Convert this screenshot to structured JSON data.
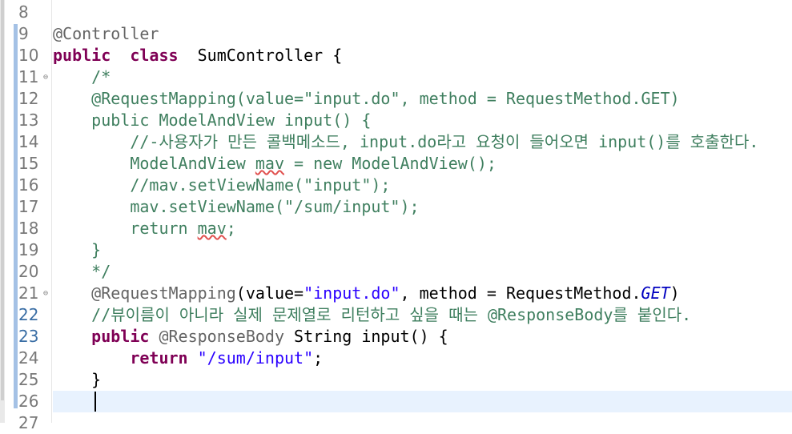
{
  "editor": {
    "lines": [
      {
        "n": "8",
        "segs": []
      },
      {
        "n": "9",
        "segs": [
          [
            "ann",
            "@Controller"
          ]
        ]
      },
      {
        "n": "10",
        "segs": [
          [
            "kw",
            "public"
          ],
          [
            "",
            "  "
          ],
          [
            "kw",
            "class"
          ],
          [
            "",
            "  SumController {"
          ]
        ]
      },
      {
        "n": "11",
        "fold": true,
        "segs": [
          [
            "",
            "    "
          ],
          [
            "cm",
            "/*"
          ]
        ]
      },
      {
        "n": "12",
        "segs": [
          [
            "",
            "    "
          ],
          [
            "cm",
            "@RequestMapping(value=\"input.do\", method = RequestMethod.GET)"
          ]
        ]
      },
      {
        "n": "13",
        "segs": [
          [
            "",
            "    "
          ],
          [
            "cm",
            "public ModelAndView input() {"
          ]
        ]
      },
      {
        "n": "14",
        "segs": [
          [
            "",
            "        "
          ],
          [
            "cm",
            "//-사용자가 만든 콜백메소드, input.do라고 요청이 들어오면 input()를 호출한다."
          ]
        ]
      },
      {
        "n": "15",
        "segs": [
          [
            "",
            "        "
          ],
          [
            "cm",
            "ModelAndView "
          ],
          [
            "cm warn",
            "mav"
          ],
          [
            "cm",
            " = new ModelAndView();"
          ]
        ]
      },
      {
        "n": "16",
        "segs": [
          [
            "",
            "        "
          ],
          [
            "cm",
            "//mav.setViewName(\"input\");"
          ]
        ]
      },
      {
        "n": "17",
        "segs": [
          [
            "",
            "        "
          ],
          [
            "cm",
            "mav.setViewName(\"/sum/input\");"
          ]
        ]
      },
      {
        "n": "18",
        "segs": [
          [
            "",
            "        "
          ],
          [
            "cm",
            "return "
          ],
          [
            "cm warn",
            "mav"
          ],
          [
            "cm",
            ";"
          ]
        ]
      },
      {
        "n": "19",
        "segs": [
          [
            "",
            "    "
          ],
          [
            "cm",
            "}"
          ]
        ]
      },
      {
        "n": "20",
        "segs": [
          [
            "",
            "    "
          ],
          [
            "cm",
            "*/"
          ]
        ]
      },
      {
        "n": "21",
        "fold": true,
        "segs": [
          [
            "",
            "    "
          ],
          [
            "ann",
            "@RequestMapping"
          ],
          [
            "",
            "(value="
          ],
          [
            "str",
            "\"input.do\""
          ],
          [
            "",
            ", method = RequestMethod."
          ],
          [
            "static",
            "GET"
          ],
          [
            "",
            ")"
          ]
        ]
      },
      {
        "n": "22",
        "active": true,
        "segs": [
          [
            "",
            "    "
          ],
          [
            "cm",
            "//뷰이름이 아니라 실제 문제열로 리턴하고 싶을 때는 @ResponseBody를 붙인다."
          ]
        ]
      },
      {
        "n": "23",
        "active": true,
        "segs": [
          [
            "",
            "    "
          ],
          [
            "kw",
            "public"
          ],
          [
            "",
            " "
          ],
          [
            "ann",
            "@ResponseBody"
          ],
          [
            "",
            " String input() {"
          ]
        ]
      },
      {
        "n": "24",
        "segs": [
          [
            "",
            "        "
          ],
          [
            "kw",
            "return"
          ],
          [
            "",
            " "
          ],
          [
            "str",
            "\"/sum/input\""
          ],
          [
            "",
            ";"
          ]
        ]
      },
      {
        "n": "25",
        "segs": [
          [
            "",
            "    }"
          ]
        ]
      },
      {
        "n": "26",
        "current": true,
        "segs": []
      },
      {
        "n": "27",
        "segs": []
      }
    ]
  },
  "colors": {
    "keyword": "#7f0055",
    "annotation": "#646464",
    "string": "#2a00ff",
    "comment": "#3f7f5f",
    "current_line": "#e8f2fe"
  }
}
